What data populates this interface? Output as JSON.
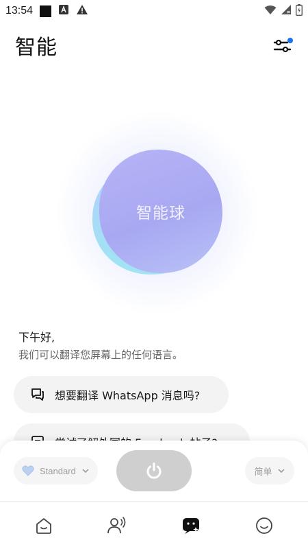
{
  "status_bar": {
    "time": "13:54",
    "icons": [
      "notification-square-icon",
      "app-a-icon",
      "warning-icon",
      "wifi-icon",
      "signal-icon",
      "battery-icon"
    ]
  },
  "header": {
    "title": "智能",
    "settings_icon": "sliders-icon",
    "settings_badge_color": "#1a73e8"
  },
  "orb": {
    "label": "智能球"
  },
  "greeting": {
    "title": "下午好,",
    "subtitle": "我们可以翻译您屏幕上的任何语言。"
  },
  "suggestions": [
    {
      "icon": "chat-bubbles-icon",
      "text": "想要翻译 WhatsApp 消息吗?"
    },
    {
      "icon": "image-frame-icon",
      "text": "尝试了解外国的 Facebook 帖子?"
    }
  ],
  "controls": {
    "mode_label": "Standard",
    "mode_icon": "heart-icon",
    "power_icon": "power-icon",
    "language_label": "简单"
  },
  "bottom_nav": [
    {
      "name": "home",
      "icon": "home-icon",
      "active": false
    },
    {
      "name": "voice",
      "icon": "voice-person-icon",
      "active": false
    },
    {
      "name": "smart",
      "icon": "smart-translate-icon",
      "active": true
    },
    {
      "name": "profile",
      "icon": "smile-icon",
      "active": false
    }
  ],
  "colors": {
    "accent": "#1a73e8",
    "orb": "#aeaaf3",
    "power_button": "#cfcfcf",
    "chip_bg": "#f3f3f3"
  }
}
